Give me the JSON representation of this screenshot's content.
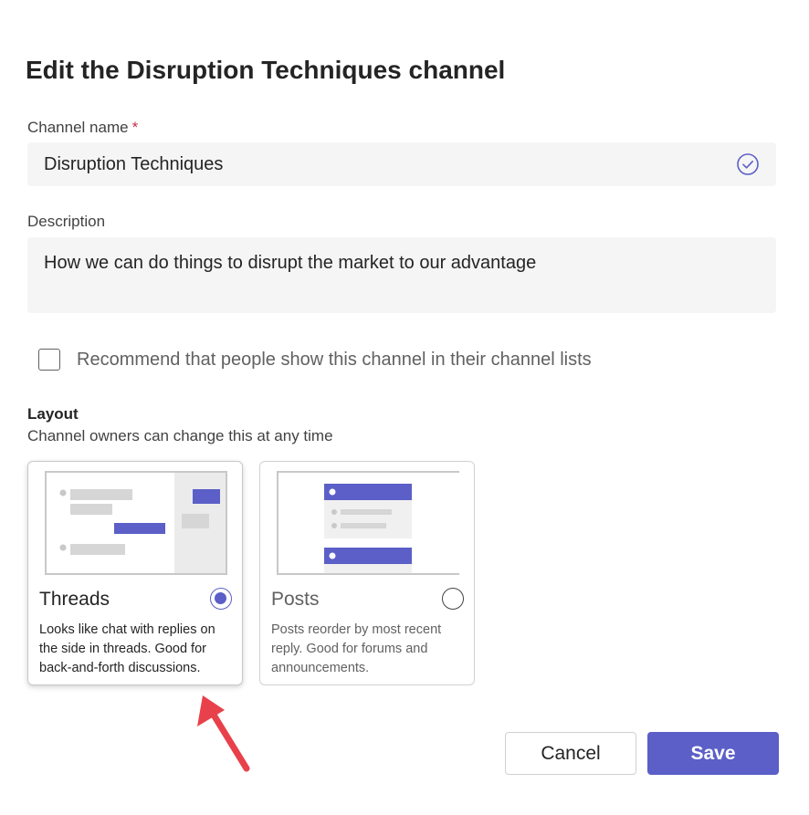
{
  "dialog": {
    "title_prefix": "Edit the",
    "title_channel": "Disruption Techniques",
    "title_suffix": "channel"
  },
  "channel_name": {
    "label": "Channel name",
    "required_marker": "*",
    "value": "Disruption Techniques",
    "status_icon": "check-circle-icon"
  },
  "description": {
    "label": "Description",
    "value": "How we can do things to disrupt the market to our advantage"
  },
  "recommend": {
    "label": "Recommend that people show this channel in their channel lists",
    "checked": false
  },
  "layout": {
    "heading": "Layout",
    "subheading": "Channel owners can change this at any time",
    "options": [
      {
        "name": "Threads",
        "description": "Looks like chat with replies on the side in threads. Good for back-and-forth discussions.",
        "selected": true
      },
      {
        "name": "Posts",
        "description": "Posts reorder by most recent reply. Good for forums and announcements.",
        "selected": false
      }
    ]
  },
  "actions": {
    "cancel_label": "Cancel",
    "save_label": "Save"
  },
  "colors": {
    "accent": "#5b5fc7",
    "annotation_arrow": "#e8414b"
  }
}
